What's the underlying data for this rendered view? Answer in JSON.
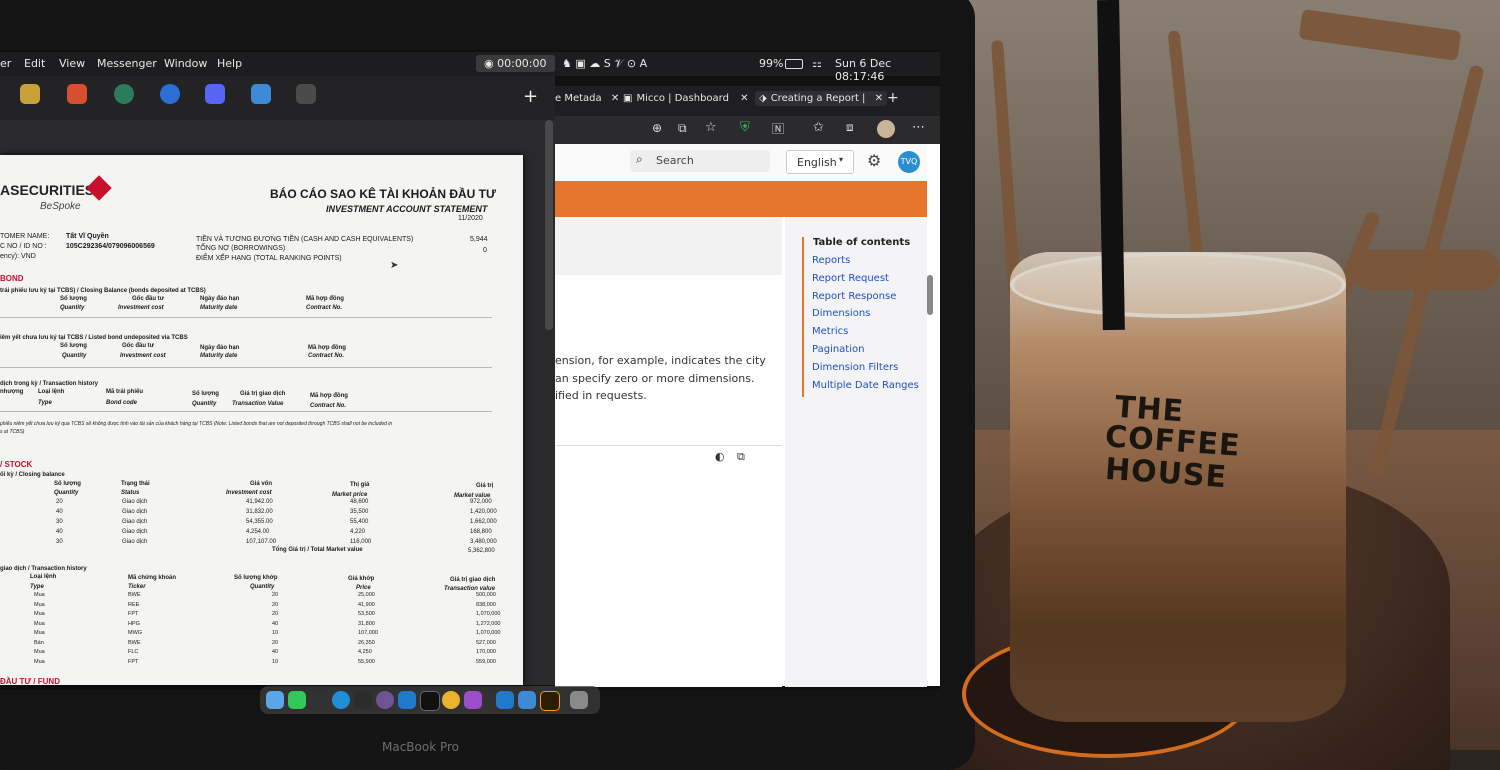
{
  "menubar": {
    "items": [
      "er",
      "Edit",
      "View",
      "Messenger",
      "Window",
      "Help"
    ],
    "timer": "00:00:00",
    "battery": "99%",
    "clock": "Sun 6 Dec  08:17:46"
  },
  "browser": {
    "tabs": [
      "e Metada",
      "Micco | Dashboard",
      "Creating a Report |"
    ],
    "search_placeholder": "Search",
    "language": "English",
    "avatar": "TVQ",
    "body_lines": [
      "ension, for example, indicates the city",
      "an specify zero or more dimensions.",
      "ified in requests."
    ],
    "toc_title": "Table of contents",
    "toc_items": [
      "Reports",
      "Report Request",
      "Report Response",
      "Dimensions",
      "Metrics",
      "Pagination",
      "Dimension Filters",
      "Multiple Date Ranges"
    ]
  },
  "statement": {
    "brand": "ASECURITIES",
    "brand_sub": "BeSpoke",
    "title_vi": "BÁO CÁO SAO KÊ TÀI KHOẢN ĐẦU TƯ",
    "title_en": "INVESTMENT ACCOUNT STATEMENT",
    "date": "11/2020",
    "customer_label": "TOMER NAME:",
    "customer_name": "Tất Vĩ Quyền",
    "id_label": "C NO / ID NO :",
    "id_value": "105C292364/079096006569",
    "currency": "ency): VND",
    "cash_label": "TIỀN VÀ TƯƠNG ĐƯƠNG TIỀN (CASH AND CASH EQUIVALENTS)",
    "cash_value": "5,944",
    "debt_label": "TỔNG NỢ (BORROWINGS)",
    "debt_value": "0",
    "rank_label": "ĐIỂM XẾP HẠNG (TOTAL RANKING POINTS)",
    "bond": "BOND",
    "bond_sub": "trái phiếu lưu ký tại TCBS) / Closing Balance (bonds deposited at TCBS)",
    "bond_cols": [
      "Số lượng",
      "Gốc đầu tư",
      "Ngày đáo hạn",
      "Mã hợp đồng"
    ],
    "bond_cols_en": [
      "Quantity",
      "Investment cost",
      "Maturity date",
      "Contract No."
    ],
    "listed_sub": "iêm yết chưa lưu ký tại TCBS / Listed bond undeposited via TCBS",
    "trans_sub": "dịch trong kỳ / Transaction history",
    "trans_cols": [
      "nhượng",
      "Loại lệnh",
      "Mã trái phiếu",
      "Số lượng",
      "Giá trị giao dịch",
      "Mã hợp đồng"
    ],
    "trans_cols_en": [
      "Type",
      "Bond code",
      "Quantity",
      "Transaction Value",
      "Contract No."
    ],
    "note": "phiếu niêm yết chưa lưu ký qua TCBS sẽ không được tính vào tài sản của khách hàng tại TCBS (Note: Listed bonds that are not deposited through TCBS shall not be included in",
    "note2": "s at TCBS)",
    "stock": "/ STOCK",
    "stock_sub": "ối kỳ / Closing balance",
    "stock_cols": [
      "Số lượng",
      "Trạng thái",
      "Giá vốn",
      "Thị giá",
      "Giá trị"
    ],
    "stock_cols_en": [
      "Quantity",
      "Status",
      "Investment cost",
      "Market price",
      "Market value"
    ],
    "stock_rows": [
      [
        "20",
        "Giao dịch",
        "41,942.00",
        "48,600",
        "972,000"
      ],
      [
        "40",
        "Giao dịch",
        "31,832.00",
        "35,500",
        "1,420,000"
      ],
      [
        "30",
        "Giao dịch",
        "54,355.00",
        "55,400",
        "1,662,000"
      ],
      [
        "40",
        "Giao dịch",
        "4,254.00",
        "4,220",
        "168,800"
      ],
      [
        "30",
        "Giao dịch",
        "107,107.00",
        "116,000",
        "3,480,000"
      ]
    ],
    "stock_total_label": "Tổng Giá trị / Total Market value",
    "stock_total": "5,362,800",
    "hist_sub": "giao dịch / Transaction history",
    "hist_cols": [
      "Loại lệnh",
      "Mã chứng khoán",
      "Số lượng khớp",
      "Giá khớp",
      "Giá trị giao dịch"
    ],
    "hist_cols_en": [
      "Type",
      "Ticker",
      "Quantity",
      "Price",
      "Transaction value"
    ],
    "hist_rows": [
      [
        "Mua",
        "BWE",
        "20",
        "25,000",
        "500,000"
      ],
      [
        "Mua",
        "REE",
        "20",
        "41,900",
        "838,000"
      ],
      [
        "Mua",
        "FPT",
        "20",
        "53,500",
        "1,070,000"
      ],
      [
        "Mua",
        "HPG",
        "40",
        "31,800",
        "1,272,000"
      ],
      [
        "Mua",
        "MWG",
        "10",
        "107,000",
        "1,070,000"
      ],
      [
        "Bán",
        "BWE",
        "20",
        "26,350",
        "527,000"
      ],
      [
        "Mua",
        "FLC",
        "40",
        "4,250",
        "170,000"
      ],
      [
        "Mua",
        "FPT",
        "10",
        "55,900",
        "559,000"
      ]
    ],
    "fund": "ĐẦU TƯ / FUND"
  },
  "glass": {
    "logo_line1": "THE",
    "logo_line2": "COFFEE",
    "logo_line3": "HOUSE"
  },
  "laptop_label": "MacBook Pro"
}
